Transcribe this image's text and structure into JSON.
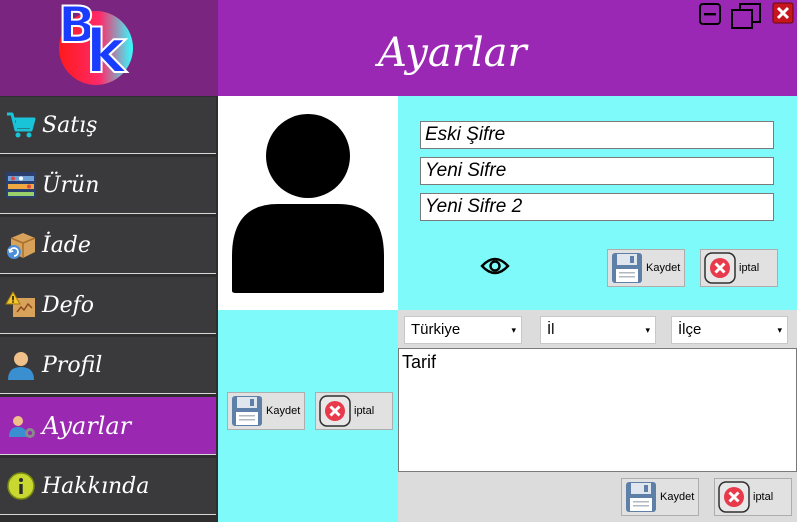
{
  "app": {
    "title": "Ayarlar"
  },
  "sidebar": {
    "items": [
      {
        "label": "Satış",
        "icon": "shopping-cart-icon"
      },
      {
        "label": "Ürün",
        "icon": "product-shelf-icon"
      },
      {
        "label": "İade",
        "icon": "return-box-icon"
      },
      {
        "label": "Defo",
        "icon": "defect-box-icon"
      },
      {
        "label": "Profil",
        "icon": "user-profile-icon"
      },
      {
        "label": "Ayarlar",
        "icon": "settings-users-icon",
        "active": true
      },
      {
        "label": "Hakkında",
        "icon": "info-icon"
      }
    ]
  },
  "password": {
    "old_placeholder": "Eski Şifre",
    "new_placeholder": "Yeni Sifre",
    "new2_placeholder": "Yeni Sifre 2",
    "save_label": "Kaydet",
    "cancel_label": "iptal"
  },
  "photo": {
    "save_label": "Kaydet",
    "cancel_label": "iptal"
  },
  "address": {
    "country": "Türkiye",
    "city": "İl",
    "district": "İlçe",
    "recipe_text": "Tarif",
    "save_label": "Kaydet",
    "cancel_label": "iptal"
  },
  "colors": {
    "header": "#9a28b4",
    "active_nav": "#9a28b0",
    "panel": "#7dfaf9",
    "sidebar": "#3a3a3c"
  }
}
